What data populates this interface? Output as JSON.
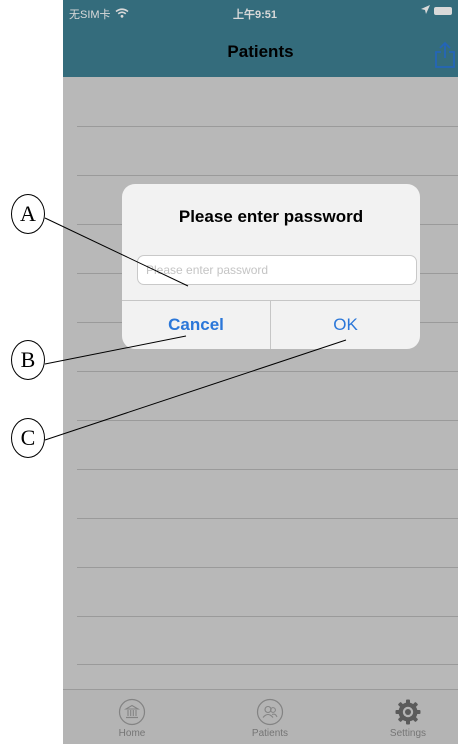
{
  "status_bar": {
    "carrier": "无SIM卡",
    "time": "上午9:51"
  },
  "nav": {
    "title": "Patients",
    "share_icon": "share-icon"
  },
  "dialog": {
    "title": "Please enter password",
    "input_placeholder": "Please enter password",
    "input_value": "",
    "cancel_label": "Cancel",
    "ok_label": "OK"
  },
  "tab_bar": {
    "items": [
      {
        "label": "Home",
        "icon": "bank-icon"
      },
      {
        "label": "Patients",
        "icon": "patients-icon"
      },
      {
        "label": "Settings",
        "icon": "gear-icon"
      }
    ]
  },
  "callouts": {
    "a": "A",
    "b": "B",
    "c": "C"
  },
  "colors": {
    "nav_bar": "#3e7f92",
    "accent": "#2b77d9",
    "background": "#d9d9d9"
  }
}
